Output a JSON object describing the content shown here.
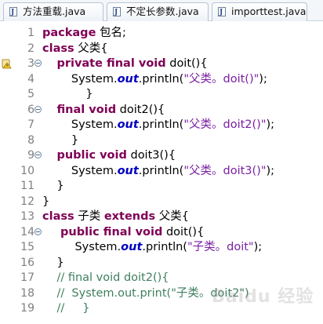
{
  "tabs": [
    {
      "label": "方法重载.java",
      "icon": "java-file-icon"
    },
    {
      "label": "不定长参数.java",
      "icon": "java-file-icon"
    },
    {
      "label": "importtest.java",
      "icon": "java-file-icon"
    }
  ],
  "lines": [
    {
      "n": "1",
      "parts": [
        {
          "t": "kw",
          "v": "package"
        },
        {
          "t": "p",
          "v": " 包名;"
        }
      ]
    },
    {
      "n": "2",
      "parts": [
        {
          "t": "kw",
          "v": "class"
        },
        {
          "t": "p",
          "v": " 父类{"
        }
      ]
    },
    {
      "n": "3",
      "fold": true,
      "warning": true,
      "parts": [
        {
          "t": "p",
          "v": "    "
        },
        {
          "t": "kw",
          "v": "private final void"
        },
        {
          "t": "p",
          "v": " doit(){"
        }
      ]
    },
    {
      "n": "4",
      "parts": [
        {
          "t": "p",
          "v": "        System."
        },
        {
          "t": "f",
          "v": "out"
        },
        {
          "t": "p",
          "v": ".println("
        },
        {
          "t": "s",
          "v": "\"父类。doit()\""
        },
        {
          "t": "p",
          "v": ");"
        }
      ]
    },
    {
      "n": "5",
      "parts": [
        {
          "t": "p",
          "v": "            }"
        }
      ]
    },
    {
      "n": "6",
      "fold": true,
      "parts": [
        {
          "t": "p",
          "v": "    "
        },
        {
          "t": "kw",
          "v": "final void"
        },
        {
          "t": "p",
          "v": " doit2(){"
        }
      ]
    },
    {
      "n": "7",
      "parts": [
        {
          "t": "p",
          "v": "        System."
        },
        {
          "t": "f",
          "v": "out"
        },
        {
          "t": "p",
          "v": ".println("
        },
        {
          "t": "s",
          "v": "\"父类。doit2()\""
        },
        {
          "t": "p",
          "v": ");"
        }
      ]
    },
    {
      "n": "8",
      "parts": [
        {
          "t": "p",
          "v": "        }"
        }
      ]
    },
    {
      "n": "9",
      "fold": true,
      "parts": [
        {
          "t": "p",
          "v": "    "
        },
        {
          "t": "kw",
          "v": "public void"
        },
        {
          "t": "p",
          "v": " doit3(){"
        }
      ]
    },
    {
      "n": "10",
      "parts": [
        {
          "t": "p",
          "v": "        System."
        },
        {
          "t": "f",
          "v": "out"
        },
        {
          "t": "p",
          "v": ".println("
        },
        {
          "t": "s",
          "v": "\"父类。doit3()\""
        },
        {
          "t": "p",
          "v": ");"
        }
      ]
    },
    {
      "n": "11",
      "parts": [
        {
          "t": "p",
          "v": "    }"
        }
      ]
    },
    {
      "n": "12",
      "parts": [
        {
          "t": "p",
          "v": "}"
        }
      ]
    },
    {
      "n": "13",
      "parts": [
        {
          "t": "kw",
          "v": "class"
        },
        {
          "t": "p",
          "v": " 子类 "
        },
        {
          "t": "kw",
          "v": "extends"
        },
        {
          "t": "p",
          "v": " 父类{"
        }
      ]
    },
    {
      "n": "14",
      "fold": true,
      "parts": [
        {
          "t": "p",
          "v": "     "
        },
        {
          "t": "kw",
          "v": "public final void"
        },
        {
          "t": "p",
          "v": " doit(){"
        }
      ]
    },
    {
      "n": "15",
      "parts": [
        {
          "t": "p",
          "v": "         System."
        },
        {
          "t": "f",
          "v": "out"
        },
        {
          "t": "p",
          "v": ".println("
        },
        {
          "t": "s",
          "v": "\"子类。doit\""
        },
        {
          "t": "p",
          "v": ");"
        }
      ]
    },
    {
      "n": "16",
      "parts": [
        {
          "t": "p",
          "v": "    }"
        }
      ]
    },
    {
      "n": "17",
      "parts": [
        {
          "t": "p",
          "v": "    "
        },
        {
          "t": "c",
          "v": "// final void doit2(){"
        }
      ]
    },
    {
      "n": "18",
      "parts": [
        {
          "t": "p",
          "v": "    "
        },
        {
          "t": "c",
          "v": "//  System.out.print(\"子类。doit2\")"
        }
      ]
    },
    {
      "n": "19",
      "parts": [
        {
          "t": "p",
          "v": "    "
        },
        {
          "t": "c",
          "v": "//     }"
        }
      ]
    }
  ],
  "colors": {
    "keyword": "#7f0055",
    "string": "#7a1fa2",
    "comment": "#3f7f5f",
    "field": "#0000c0",
    "line_number": "#7f7f7f"
  }
}
